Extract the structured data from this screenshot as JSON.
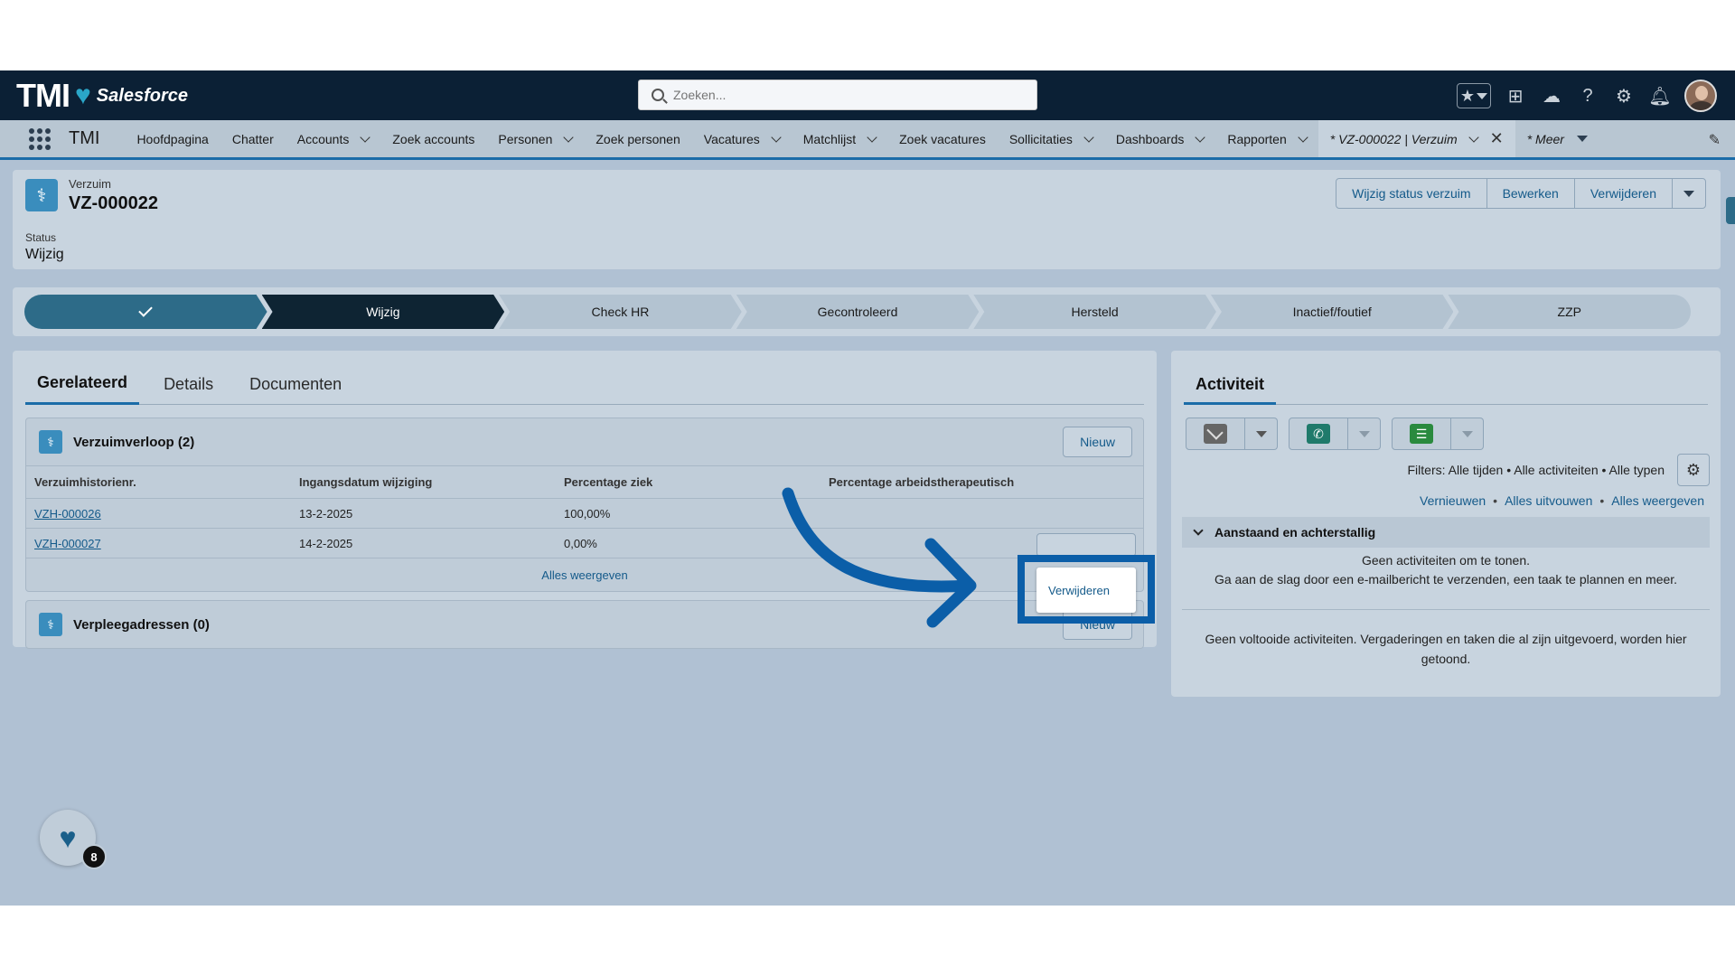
{
  "header": {
    "logo_text": "TMI",
    "logo_sub": "Salesforce",
    "search_placeholder": "Zoeken..."
  },
  "nav": {
    "app_name": "TMI",
    "items": [
      {
        "label": "Hoofdpagina",
        "dropdown": false
      },
      {
        "label": "Chatter",
        "dropdown": false
      },
      {
        "label": "Accounts",
        "dropdown": true
      },
      {
        "label": "Zoek accounts",
        "dropdown": false
      },
      {
        "label": "Personen",
        "dropdown": true
      },
      {
        "label": "Zoek personen",
        "dropdown": false
      },
      {
        "label": "Vacatures",
        "dropdown": true
      },
      {
        "label": "Matchlijst",
        "dropdown": true
      },
      {
        "label": "Zoek vacatures",
        "dropdown": false
      },
      {
        "label": "Sollicitaties",
        "dropdown": true
      },
      {
        "label": "Dashboards",
        "dropdown": true
      },
      {
        "label": "Rapporten",
        "dropdown": true
      }
    ],
    "active_tab": "* VZ-000022 | Verzuim",
    "more": "* Meer"
  },
  "record": {
    "object": "Verzuim",
    "name": "VZ-000022",
    "actions": [
      "Wijzig status verzuim",
      "Bewerken",
      "Verwijderen"
    ],
    "status_label": "Status",
    "status_value": "Wijzig"
  },
  "path": {
    "steps": [
      "",
      "Wijzig",
      "Check HR",
      "Gecontroleerd",
      "Hersteld",
      "Inactief/foutief",
      "ZZP"
    ],
    "current_index": 1
  },
  "tabs": [
    "Gerelateerd",
    "Details",
    "Documenten"
  ],
  "verzuimverloop": {
    "title": "Verzuimverloop (2)",
    "new_label": "Nieuw",
    "columns": [
      "Verzuimhistorienr.",
      "Ingangsdatum wijziging",
      "Percentage ziek",
      "Percentage arbeidstherapeutisch"
    ],
    "rows": [
      [
        "VZH-000026",
        "13-2-2025",
        "100,00%",
        ""
      ],
      [
        "VZH-000027",
        "14-2-2025",
        "0,00%",
        ""
      ]
    ],
    "show_all": "Alles weergeven",
    "row_menu_item": "Verwijderen"
  },
  "verpleegadressen": {
    "title": "Verpleegadressen (0)",
    "new_label": "Nieuw"
  },
  "activity": {
    "title": "Activiteit",
    "filters": "Filters: Alle tijden • Alle activiteiten • Alle typen",
    "links": [
      "Vernieuwen",
      "Alles uitvouwen",
      "Alles weergeven"
    ],
    "section_title": "Aanstaand en achterstallig",
    "empty_line1": "Geen activiteiten om te tonen.",
    "empty_line2": "Ga aan de slag door een e-mailbericht te verzenden, een taak te plannen en meer.",
    "empty_past": "Geen voltooide activiteiten. Vergaderingen en taken die al zijn uitgevoerd, worden hier getoond."
  },
  "widget": {
    "badge_count": "8"
  },
  "colors": {
    "brand_dark": "#0b2035",
    "accent": "#1b6ca8",
    "highlight": "#0b5ea8"
  }
}
